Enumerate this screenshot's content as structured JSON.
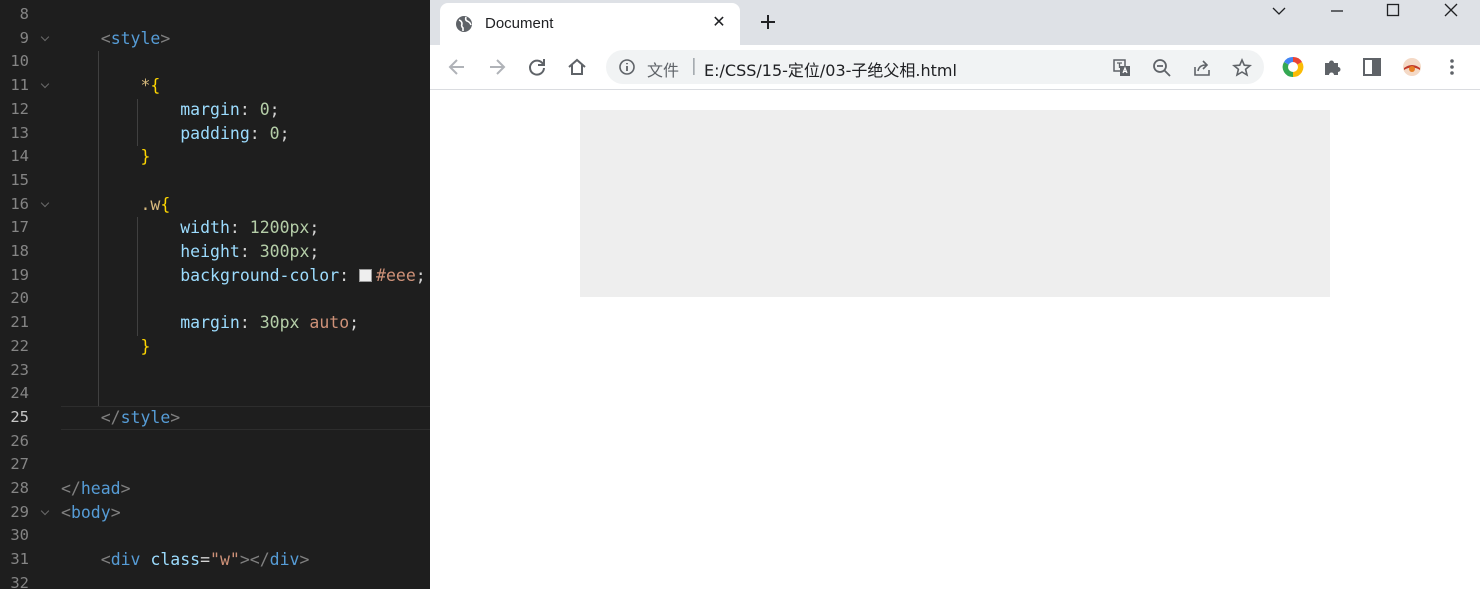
{
  "editor": {
    "lines": [
      {
        "num": "8",
        "fold": false,
        "tokens": []
      },
      {
        "num": "9",
        "fold": true,
        "tokens": [
          {
            "t": "    ",
            "c": "t-text"
          },
          {
            "t": "<",
            "c": "t-punc"
          },
          {
            "t": "style",
            "c": "t-tag"
          },
          {
            "t": ">",
            "c": "t-punc"
          }
        ]
      },
      {
        "num": "10",
        "fold": false,
        "tokens": []
      },
      {
        "num": "11",
        "fold": true,
        "tokens": [
          {
            "t": "        ",
            "c": "t-text"
          },
          {
            "t": "*",
            "c": "t-sel"
          },
          {
            "t": "{",
            "c": "t-brace"
          }
        ]
      },
      {
        "num": "12",
        "fold": false,
        "tokens": [
          {
            "t": "            ",
            "c": "t-text"
          },
          {
            "t": "margin",
            "c": "t-prop"
          },
          {
            "t": ": ",
            "c": "t-text"
          },
          {
            "t": "0",
            "c": "t-num"
          },
          {
            "t": ";",
            "c": "t-text"
          }
        ]
      },
      {
        "num": "13",
        "fold": false,
        "tokens": [
          {
            "t": "            ",
            "c": "t-text"
          },
          {
            "t": "padding",
            "c": "t-prop"
          },
          {
            "t": ": ",
            "c": "t-text"
          },
          {
            "t": "0",
            "c": "t-num"
          },
          {
            "t": ";",
            "c": "t-text"
          }
        ]
      },
      {
        "num": "14",
        "fold": false,
        "tokens": [
          {
            "t": "        ",
            "c": "t-text"
          },
          {
            "t": "}",
            "c": "t-brace"
          }
        ]
      },
      {
        "num": "15",
        "fold": false,
        "tokens": []
      },
      {
        "num": "16",
        "fold": true,
        "tokens": [
          {
            "t": "        ",
            "c": "t-text"
          },
          {
            "t": ".w",
            "c": "t-sel"
          },
          {
            "t": "{",
            "c": "t-brace"
          }
        ]
      },
      {
        "num": "17",
        "fold": false,
        "tokens": [
          {
            "t": "            ",
            "c": "t-text"
          },
          {
            "t": "width",
            "c": "t-prop"
          },
          {
            "t": ": ",
            "c": "t-text"
          },
          {
            "t": "1200px",
            "c": "t-num"
          },
          {
            "t": ";",
            "c": "t-text"
          }
        ]
      },
      {
        "num": "18",
        "fold": false,
        "tokens": [
          {
            "t": "            ",
            "c": "t-text"
          },
          {
            "t": "height",
            "c": "t-prop"
          },
          {
            "t": ": ",
            "c": "t-text"
          },
          {
            "t": "300px",
            "c": "t-num"
          },
          {
            "t": ";",
            "c": "t-text"
          }
        ]
      },
      {
        "num": "19",
        "fold": false,
        "tokens": [
          {
            "t": "            ",
            "c": "t-text"
          },
          {
            "t": "background-color",
            "c": "t-prop"
          },
          {
            "t": ": ",
            "c": "t-text"
          },
          {
            "t": "",
            "c": "swatch"
          },
          {
            "t": "#eee",
            "c": "t-val"
          },
          {
            "t": ";",
            "c": "t-text"
          }
        ]
      },
      {
        "num": "20",
        "fold": false,
        "tokens": []
      },
      {
        "num": "21",
        "fold": false,
        "tokens": [
          {
            "t": "            ",
            "c": "t-text"
          },
          {
            "t": "margin",
            "c": "t-prop"
          },
          {
            "t": ": ",
            "c": "t-text"
          },
          {
            "t": "30px",
            "c": "t-num"
          },
          {
            "t": " ",
            "c": "t-text"
          },
          {
            "t": "auto",
            "c": "t-val"
          },
          {
            "t": ";",
            "c": "t-text"
          }
        ]
      },
      {
        "num": "22",
        "fold": false,
        "tokens": [
          {
            "t": "        ",
            "c": "t-text"
          },
          {
            "t": "}",
            "c": "t-brace"
          }
        ]
      },
      {
        "num": "23",
        "fold": false,
        "tokens": []
      },
      {
        "num": "24",
        "fold": false,
        "tokens": []
      },
      {
        "num": "25",
        "fold": false,
        "active": true,
        "tokens": [
          {
            "t": "    ",
            "c": "t-text"
          },
          {
            "t": "</",
            "c": "t-punc"
          },
          {
            "t": "style",
            "c": "t-tag"
          },
          {
            "t": ">",
            "c": "t-punc"
          }
        ]
      },
      {
        "num": "26",
        "fold": false,
        "tokens": []
      },
      {
        "num": "27",
        "fold": false,
        "tokens": []
      },
      {
        "num": "28",
        "fold": false,
        "tokens": [
          {
            "t": "</",
            "c": "t-punc"
          },
          {
            "t": "head",
            "c": "t-tag"
          },
          {
            "t": ">",
            "c": "t-punc"
          }
        ]
      },
      {
        "num": "29",
        "fold": true,
        "tokens": [
          {
            "t": "<",
            "c": "t-punc"
          },
          {
            "t": "body",
            "c": "t-tag"
          },
          {
            "t": ">",
            "c": "t-punc"
          }
        ]
      },
      {
        "num": "30",
        "fold": false,
        "tokens": []
      },
      {
        "num": "31",
        "fold": false,
        "tokens": [
          {
            "t": "    ",
            "c": "t-text"
          },
          {
            "t": "<",
            "c": "t-punc"
          },
          {
            "t": "div",
            "c": "t-tag"
          },
          {
            "t": " ",
            "c": "t-text"
          },
          {
            "t": "class",
            "c": "t-prop"
          },
          {
            "t": "=",
            "c": "t-text"
          },
          {
            "t": "\"w\"",
            "c": "t-val"
          },
          {
            "t": "></",
            "c": "t-punc"
          },
          {
            "t": "div",
            "c": "t-tag"
          },
          {
            "t": ">",
            "c": "t-punc"
          }
        ]
      },
      {
        "num": "32",
        "fold": false,
        "tokens": []
      }
    ]
  },
  "browser": {
    "tab": {
      "title": "Document",
      "icon": "globe-icon",
      "close_label": "✕"
    },
    "new_tab_icon": "plus-icon",
    "window_controls": [
      "chevron-down-icon",
      "minimize-icon",
      "maximize-icon",
      "close-window-icon"
    ],
    "nav": [
      "back-arrow-icon",
      "forward-arrow-icon",
      "reload-icon",
      "home-icon"
    ],
    "omnibox": {
      "scheme_label": "文件",
      "separator": "|",
      "url": "E:/CSS/15-定位/03-子绝父相.html",
      "icons": [
        "translate-icon",
        "zoom-out-icon",
        "share-icon",
        "bookmark-star-icon"
      ]
    },
    "extensions": [
      "chrome-circle-icon",
      "puzzle-extensions-icon",
      "side-panel-icon",
      "profile-avatar-icon",
      "kebab-menu-icon"
    ],
    "page": {
      "box_color": "#eeeeee"
    }
  }
}
